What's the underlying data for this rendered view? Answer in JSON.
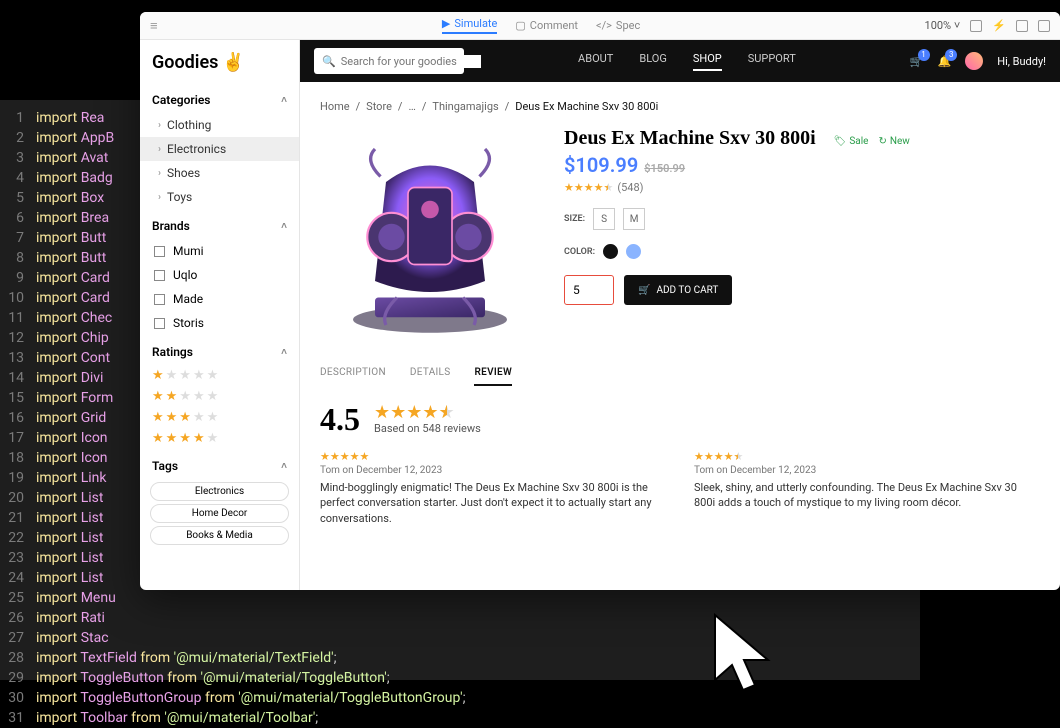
{
  "code": [
    {
      "n": 1,
      "name": "Rea",
      "rest": ""
    },
    {
      "n": 2,
      "name": "AppB",
      "rest": ""
    },
    {
      "n": 3,
      "name": "Avat",
      "rest": ""
    },
    {
      "n": 4,
      "name": "Badg",
      "rest": ""
    },
    {
      "n": 5,
      "name": "Box",
      "rest": ""
    },
    {
      "n": 6,
      "name": "Brea",
      "rest": ""
    },
    {
      "n": 7,
      "name": "Butt",
      "rest": ""
    },
    {
      "n": 8,
      "name": "Butt",
      "rest": ""
    },
    {
      "n": 9,
      "name": "Card",
      "rest": ""
    },
    {
      "n": 10,
      "name": "Card",
      "rest": ""
    },
    {
      "n": 11,
      "name": "Chec",
      "rest": ""
    },
    {
      "n": 12,
      "name": "Chip",
      "rest": ""
    },
    {
      "n": 13,
      "name": "Cont",
      "rest": ""
    },
    {
      "n": 14,
      "name": "Divi",
      "rest": ""
    },
    {
      "n": 15,
      "name": "Form",
      "rest": ""
    },
    {
      "n": 16,
      "name": "Grid",
      "rest": ""
    },
    {
      "n": 17,
      "name": "Icon",
      "rest": ""
    },
    {
      "n": 18,
      "name": "Icon",
      "rest": ""
    },
    {
      "n": 19,
      "name": "Link",
      "rest": ""
    },
    {
      "n": 20,
      "name": "List",
      "rest": ""
    },
    {
      "n": 21,
      "name": "List",
      "rest": ""
    },
    {
      "n": 22,
      "name": "List",
      "rest": ""
    },
    {
      "n": 23,
      "name": "List",
      "rest": ""
    },
    {
      "n": 24,
      "name": "List",
      "rest": ""
    },
    {
      "n": 25,
      "name": "Menu",
      "rest": ""
    },
    {
      "n": 26,
      "name": "Rati",
      "rest": ""
    },
    {
      "n": 27,
      "name": "Stac",
      "rest": ""
    }
  ],
  "code_full": [
    {
      "n": 28,
      "name": "TextField",
      "path": "@mui/material/TextField"
    },
    {
      "n": 29,
      "name": "ToggleButton",
      "path": "@mui/material/ToggleButton"
    },
    {
      "n": 30,
      "name": "ToggleButtonGroup",
      "path": "@mui/material/ToggleButtonGroup"
    },
    {
      "n": 31,
      "name": "Toolbar",
      "path": "@mui/material/Toolbar"
    }
  ],
  "topbar": {
    "simulate": "Simulate",
    "comment": "Comment",
    "spec": "Spec",
    "zoom": "100%"
  },
  "logo": "Goodies",
  "sidebar": {
    "categories": {
      "title": "Categories",
      "items": [
        "Clothing",
        "Electronics",
        "Shoes",
        "Toys"
      ]
    },
    "brands": {
      "title": "Brands",
      "items": [
        "Mumi",
        "Uqlo",
        "Made",
        "Storis"
      ]
    },
    "ratings": {
      "title": "Ratings"
    },
    "tags": {
      "title": "Tags",
      "items": [
        "Electronics",
        "Home Decor",
        "Books & Media"
      ]
    }
  },
  "search_placeholder": "Search for your goodies",
  "nav": {
    "about": "ABOUT",
    "blog": "BLOG",
    "shop": "SHOP",
    "support": "SUPPORT"
  },
  "cart_badge": "1",
  "bell_badge": "3",
  "greeting": "Hi, Buddy!",
  "breadcrumb": [
    "Home",
    "Store",
    "…",
    "Thingamajigs",
    "Deus Ex Machine Sxv 30 800i"
  ],
  "product": {
    "title": "Deus Ex Machine Sxv 30 800i",
    "sale": "Sale",
    "new": "New",
    "price": "$109.99",
    "price_old": "$150.99",
    "rating_count": "(548)",
    "size_label": "SIZE:",
    "sizes": [
      "S",
      "M"
    ],
    "color_label": "COLOR:",
    "qty": "5",
    "add_cart": "ADD TO CART"
  },
  "tabs": {
    "desc": "DESCRIPTION",
    "details": "DETAILS",
    "review": "REVIEW"
  },
  "review_summary": {
    "score": "4.5",
    "based": "Based on 548 reviews"
  },
  "reviews": [
    {
      "meta": "Tom on December 12, 2023",
      "text": "Mind-bogglingly enigmatic! The Deus Ex Machine Sxv 30 800i is the perfect conversation starter. Just don't expect it to actually start any conversations."
    },
    {
      "meta": "Tom on December 12, 2023",
      "text": "Sleek, shiny, and utterly confounding. The Deus Ex Machine Sxv 30 800i adds a touch of mystique to my living room décor."
    }
  ]
}
